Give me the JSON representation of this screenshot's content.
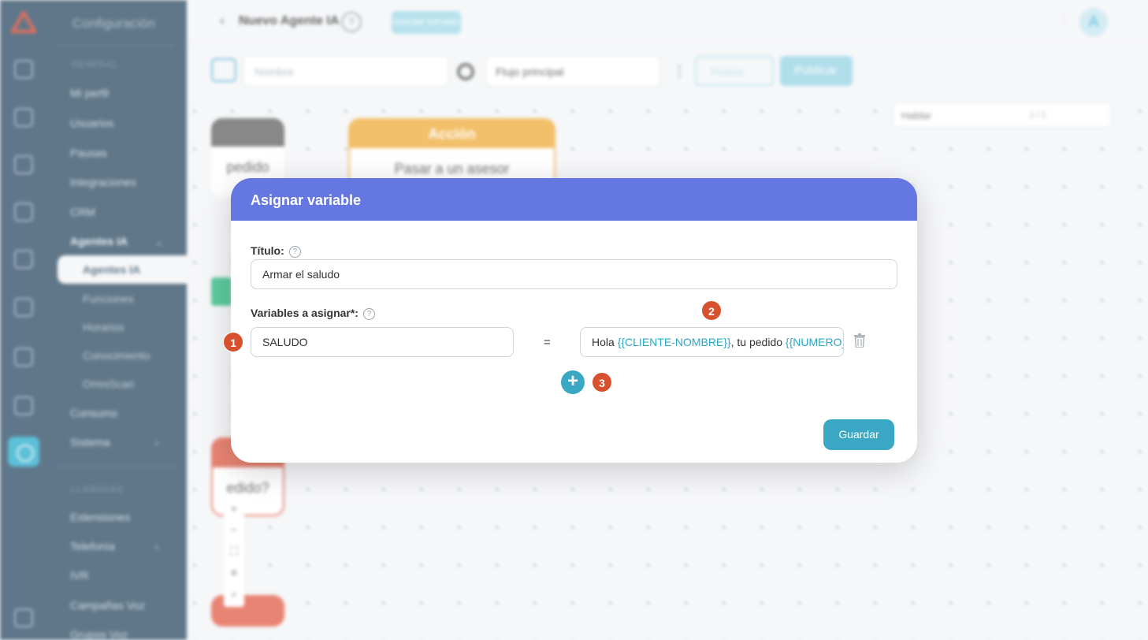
{
  "sidebar": {
    "section_title": "Configuración",
    "section_general": "GENERAL",
    "items_general": [
      "Mi perfil",
      "Usuarios",
      "Pausas",
      "Integraciones",
      "CRM"
    ],
    "agents_group": "Agentes IA",
    "agents_sub": [
      "Agentes IA",
      "Funciones",
      "Horarios",
      "Conocimiento",
      "OmniScan"
    ],
    "items_after": [
      "Consumo",
      "Sistema"
    ],
    "section_calls": "LLAMADAS",
    "items_calls": [
      "Extensiones",
      "Telefonía",
      "IVR",
      "Campañas Voz",
      "Grupos Voz"
    ]
  },
  "header": {
    "title": "Nuevo Agente IA",
    "help": "?",
    "badge": "Guardar borrador",
    "avatar": "A"
  },
  "toolbar": {
    "name_placeholder": "Nombre",
    "flow": "Flujo principal",
    "try_label": "Probar",
    "publish_label": "Publicar"
  },
  "canvas": {
    "node_left_body": "pedido",
    "node_action_title": "Acción",
    "node_action_body": "Pasar a un asesor",
    "node_lower_body": "edido?",
    "find_value": "Hablar",
    "find_count": "1 / 1"
  },
  "modal": {
    "title": "Asignar variable",
    "title_label": "Título:",
    "title_value": "Armar el saludo",
    "vars_label": "Variables a asignar*:",
    "var_name": "SALUDO",
    "equals": "=",
    "value_parts": [
      {
        "text": "Hola ",
        "var": false
      },
      {
        "text": "{{CLIENTE-NOMBRE}}",
        "var": true
      },
      {
        "text": ", tu pedido ",
        "var": false
      },
      {
        "text": "{{NUMERO_",
        "var": true
      }
    ],
    "add_label": "+",
    "save_label": "Guardar"
  },
  "callouts": [
    "1",
    "2",
    "3"
  ],
  "colors": {
    "modal_header": "#6577e1",
    "accent": "#3aa7c4",
    "variable_text": "#2aa8c8",
    "callout": "#d8512f",
    "sidebar": "#3d5a70"
  }
}
